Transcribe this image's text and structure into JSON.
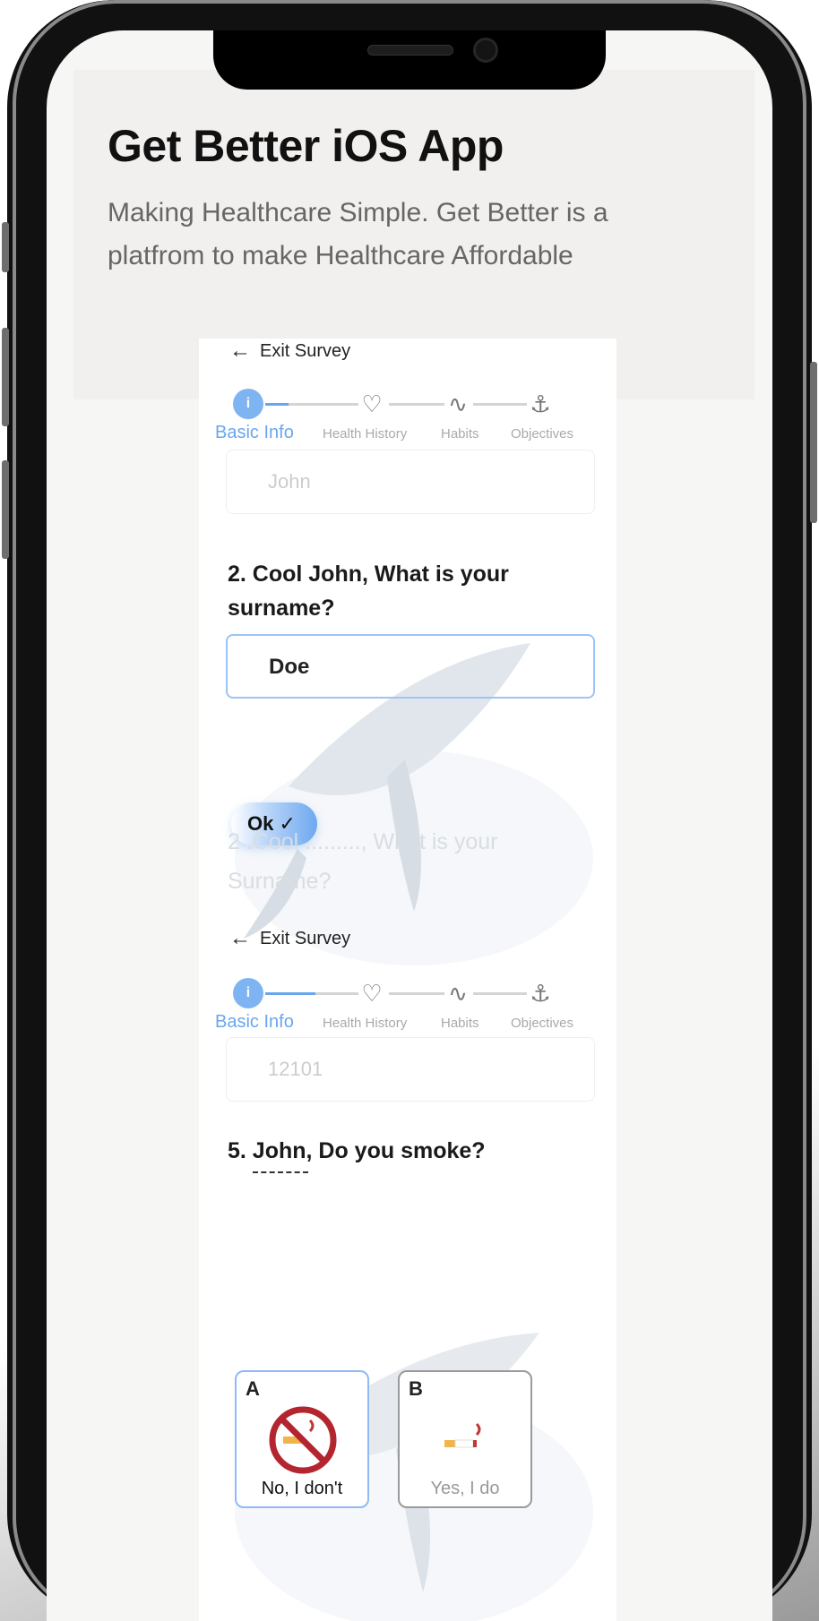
{
  "header": {
    "title": "Get Better iOS App",
    "subtitle": "Making Healthcare Simple. Get Better is a platfrom to make Healthcare Affordable"
  },
  "survey": {
    "exit_label": "Exit Survey",
    "steps": [
      "Basic Info",
      "Health History",
      "Habits",
      "Objectives"
    ],
    "screen1": {
      "prev_value": "John",
      "question": "2. Cool John, What is your surname?",
      "answer": "Doe",
      "ok_label": "Ok ✓",
      "faded_question": "2 .Cool ........., What is your Surname?"
    },
    "screen2": {
      "prev_value": "12101",
      "question": "5. John, Do you smoke?",
      "options": [
        {
          "key": "A",
          "label": "No, I don't"
        },
        {
          "key": "B",
          "label": "Yes, I do"
        }
      ]
    }
  },
  "colors": {
    "accent": "#6aa6ee",
    "background": "#f6f6f5"
  }
}
